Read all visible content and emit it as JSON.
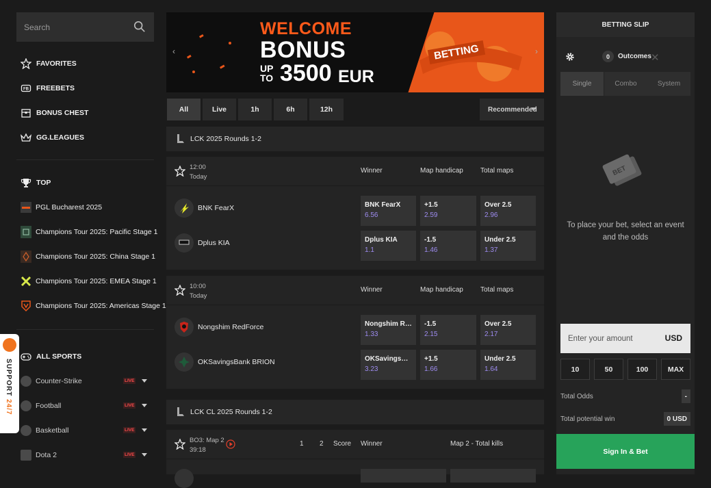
{
  "search": {
    "placeholder": "Search"
  },
  "sidebar": {
    "main": [
      {
        "label": "FAVORITES",
        "icon": "star-icon"
      },
      {
        "label": "FREEBETS",
        "icon": "freebets-icon"
      },
      {
        "label": "BONUS CHEST",
        "icon": "chest-icon"
      },
      {
        "label": "GG.LEAGUES",
        "icon": "crown-icon"
      }
    ],
    "top_label": "TOP",
    "tournaments": [
      "PGL Bucharest 2025",
      "Champions Tour 2025: Pacific Stage 1",
      "Champions Tour 2025: China Stage 1",
      "Champions Tour 2025: EMEA Stage 1",
      "Champions Tour 2025: Americas Stage 1"
    ],
    "all_sports_label": "ALL SPORTS",
    "sports": [
      {
        "label": "Counter-Strike",
        "badge": "LIVE"
      },
      {
        "label": "Football",
        "badge": "LIVE"
      },
      {
        "label": "Basketball",
        "badge": "LIVE"
      },
      {
        "label": "Dota 2",
        "badge": "LIVE"
      }
    ],
    "support": {
      "word1": "SUPPORT",
      "word2": "24/7"
    }
  },
  "banner": {
    "line1": "WELCOME",
    "line2": "BONUS",
    "line3_up": "UP",
    "line3_to": "TO",
    "line3_amount": "3500",
    "line3_cur": "EUR",
    "badge": "BETTING",
    "prev": "‹",
    "next": "›"
  },
  "filters": {
    "tabs": [
      "All",
      "Live",
      "1h",
      "6h",
      "12h"
    ],
    "active": "All",
    "sort": "Recommended"
  },
  "leagues": [
    {
      "name": "LCK 2025 Rounds 1-2",
      "matches": [
        {
          "time": "12:00",
          "day": "Today",
          "cols": [
            "Winner",
            "Map handicap",
            "Total maps"
          ],
          "teams": [
            "BNK FearX",
            "Dplus KIA"
          ],
          "odds": [
            [
              {
                "n": "BNK FearX",
                "v": "6.56"
              },
              {
                "n": "+1.5",
                "v": "2.59"
              },
              {
                "n": "Over 2.5",
                "v": "2.96"
              }
            ],
            [
              {
                "n": "Dplus KIA",
                "v": "1.1"
              },
              {
                "n": "-1.5",
                "v": "1.46"
              },
              {
                "n": "Under 2.5",
                "v": "1.37"
              }
            ]
          ]
        },
        {
          "time": "10:00",
          "day": "Today",
          "cols": [
            "Winner",
            "Map handicap",
            "Total maps"
          ],
          "teams": [
            "Nongshim RedForce",
            "OKSavingsBank BRION"
          ],
          "odds": [
            [
              {
                "n": "Nongshim RedF...",
                "v": "1.33"
              },
              {
                "n": "-1.5",
                "v": "2.15"
              },
              {
                "n": "Over 2.5",
                "v": "2.17"
              }
            ],
            [
              {
                "n": "OKSavingsBank...",
                "v": "3.23"
              },
              {
                "n": "+1.5",
                "v": "1.66"
              },
              {
                "n": "Under 2.5",
                "v": "1.64"
              }
            ]
          ]
        }
      ]
    },
    {
      "name": "LCK CL 2025 Rounds 1-2",
      "live_match": {
        "map": "BO3: Map 2",
        "clock": "39:18",
        "score_1": "1",
        "score_2": "2",
        "score_label": "Score",
        "col1": "Winner",
        "col2": "Map 2 - Total kills"
      }
    }
  ],
  "slip": {
    "title": "BETTING SLIP",
    "count": "0",
    "outcomes_label": "Outcomes",
    "tabs": [
      "Single",
      "Combo",
      "System"
    ],
    "empty_line1": "To place your bet, select an event",
    "empty_line2": "and the odds",
    "amount_placeholder": "Enter your amount",
    "currency": "USD",
    "quick": [
      "10",
      "50",
      "100",
      "MAX"
    ],
    "total_odds_label": "Total Odds",
    "total_odds_value": "-",
    "potential_label": "Total potential win",
    "potential_value": "0 USD",
    "submit": "Sign In & Bet"
  }
}
